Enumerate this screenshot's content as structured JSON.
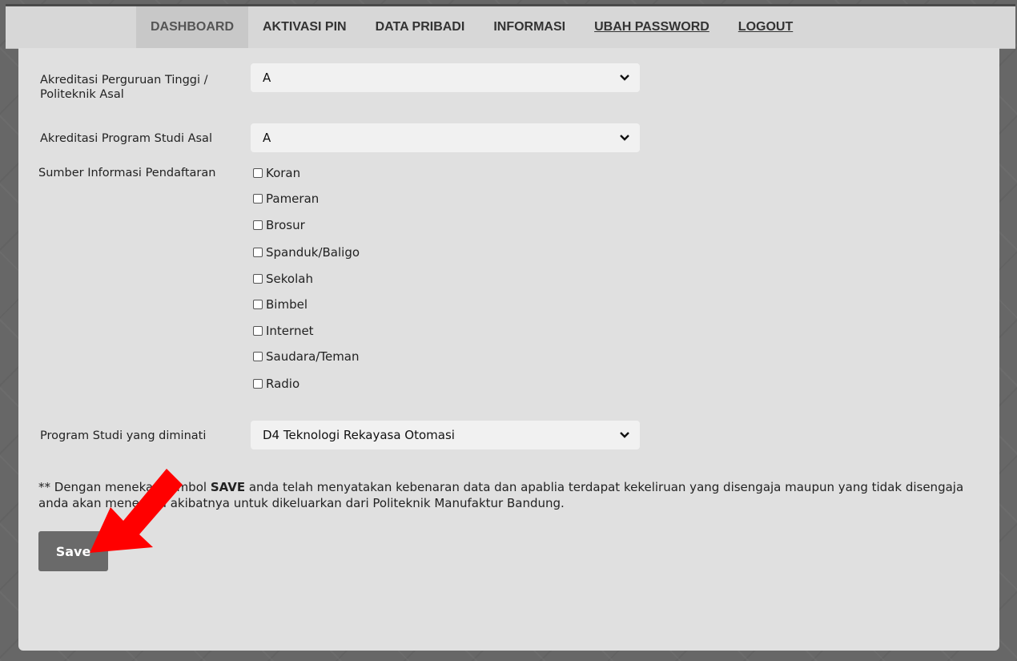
{
  "nav": {
    "items": [
      {
        "label": "DASHBOARD"
      },
      {
        "label": "AKTIVASI PIN"
      },
      {
        "label": "DATA PRIBADI"
      },
      {
        "label": "INFORMASI"
      },
      {
        "label": "UBAH PASSWORD"
      },
      {
        "label": "LOGOUT"
      }
    ]
  },
  "form": {
    "akreditasi_pt": {
      "label": "Akreditasi Perguruan Tinggi / Politeknik Asal",
      "value": "A"
    },
    "akreditasi_prodi": {
      "label": "Akreditasi Program Studi Asal",
      "value": "A"
    },
    "sumber_info": {
      "label": "Sumber Informasi Pendaftaran",
      "options": [
        {
          "label": "Koran",
          "checked": false
        },
        {
          "label": "Pameran",
          "checked": false
        },
        {
          "label": "Brosur",
          "checked": false
        },
        {
          "label": "Spanduk/Baligo",
          "checked": false
        },
        {
          "label": "Sekolah",
          "checked": false
        },
        {
          "label": "Bimbel",
          "checked": false
        },
        {
          "label": "Internet",
          "checked": false
        },
        {
          "label": "Saudara/Teman",
          "checked": false
        },
        {
          "label": "Radio",
          "checked": false
        }
      ]
    },
    "prodi_diminati": {
      "label": "Program Studi yang diminati",
      "value": "D4 Teknologi Rekayasa Otomasi"
    }
  },
  "notice": {
    "prefix": "** Dengan menekan tombol ",
    "bold": "SAVE",
    "suffix": " anda telah menyatakan kebenaran data dan apablia terdapat kekeliruan yang disengaja maupun yang tidak disengaja anda akan menerima akibatnya untuk dikeluarkan dari Politeknik Manufaktur Bandung."
  },
  "save_button": {
    "label": "Save"
  },
  "colors": {
    "annotation_arrow": "#ff0000",
    "nav_bg": "#d7d7d7",
    "card_bg": "#e0e0e0",
    "button_bg": "#6a6a6a"
  }
}
